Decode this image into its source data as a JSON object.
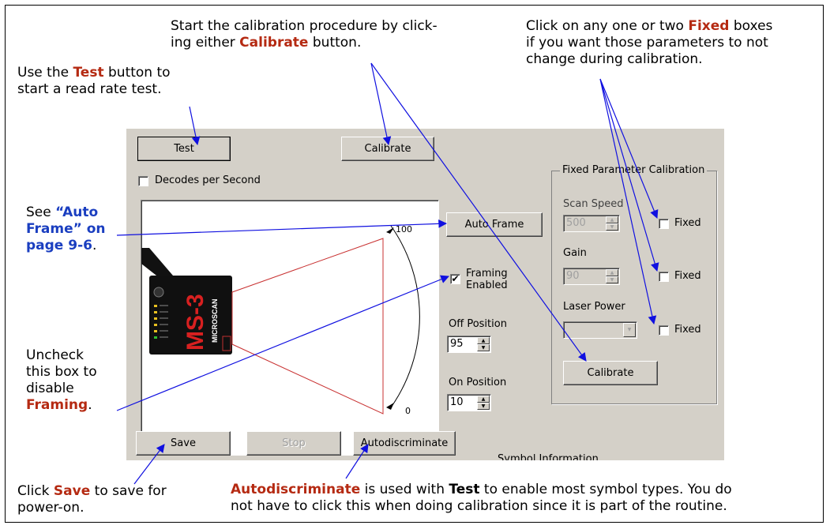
{
  "annotations": {
    "test_pre": "Use the ",
    "test_word": "Test",
    "test_post": " button to",
    "test_line2": "start a read rate test.",
    "calib_line1": "Start the calibration procedure by click-",
    "calib_pre": "ing either ",
    "calib_word": "Calibrate",
    "calib_post": " button.",
    "fixed_pre": "Click on any one or two ",
    "fixed_word": "Fixed",
    "fixed_post": " boxes",
    "fixed_line2": "if you want those parameters to not",
    "fixed_line3": "change during calibration.",
    "see_word": "See ",
    "auto_ref_1": "“Auto",
    "auto_ref_2": "Frame” on",
    "auto_ref_3": "page 9-6",
    "auto_ref_period": ".",
    "uncheck_1": "Uncheck",
    "uncheck_2": "this box to",
    "uncheck_3": "disable",
    "uncheck_word": "Framing",
    "uncheck_period": ".",
    "save_pre": "Click ",
    "save_word": "Save",
    "save_post": " to save for",
    "save_line2": "power-on.",
    "auto_word": "Autodiscriminate",
    "auto_mid": " is used with ",
    "auto_test": "Test",
    "auto_post": " to enable most symbol types. You do",
    "auto_line2": "not have to click this when doing calibration since it is part of the routine."
  },
  "panel": {
    "test_button": "Test",
    "calibrate_top_button": "Calibrate",
    "decodes_label": "Decodes per Second",
    "decodes_checked": false,
    "auto_frame_button": "Auto Frame",
    "framing_label_1": "Framing",
    "framing_label_2": "Enabled",
    "framing_checked": true,
    "framing_check_glyph": "✔",
    "off_position_label": "Off Position",
    "off_position_value": "95",
    "on_position_label": "On Position",
    "on_position_value": "10",
    "scale_top": "100",
    "scale_bottom": "0",
    "scanner_model": "MS-3",
    "scanner_brand": "MICROSCAN",
    "save_button": "Save",
    "stop_button": "Stop",
    "autodiscriminate_button": "Autodiscriminate",
    "symbol_info_label": "Symbol Information",
    "fixed_group_title": "Fixed Parameter Calibration",
    "scan_speed_label": "Scan Speed",
    "scan_speed_value": "500",
    "gain_label": "Gain",
    "gain_value": "90",
    "laser_power_label": "Laser Power",
    "laser_power_value": "",
    "fixed_label": "Fixed",
    "calibrate_bottom_button": "Calibrate",
    "spin_up": "▲",
    "spin_down": "▼",
    "dropdown_arrow": "▼"
  },
  "colors": {
    "highlight_red": "#b52a12",
    "link_blue": "#1a3ec0",
    "callout_blue": "#1010e0",
    "panel_gray": "#d4d0c8",
    "frame_red": "#c83030"
  }
}
